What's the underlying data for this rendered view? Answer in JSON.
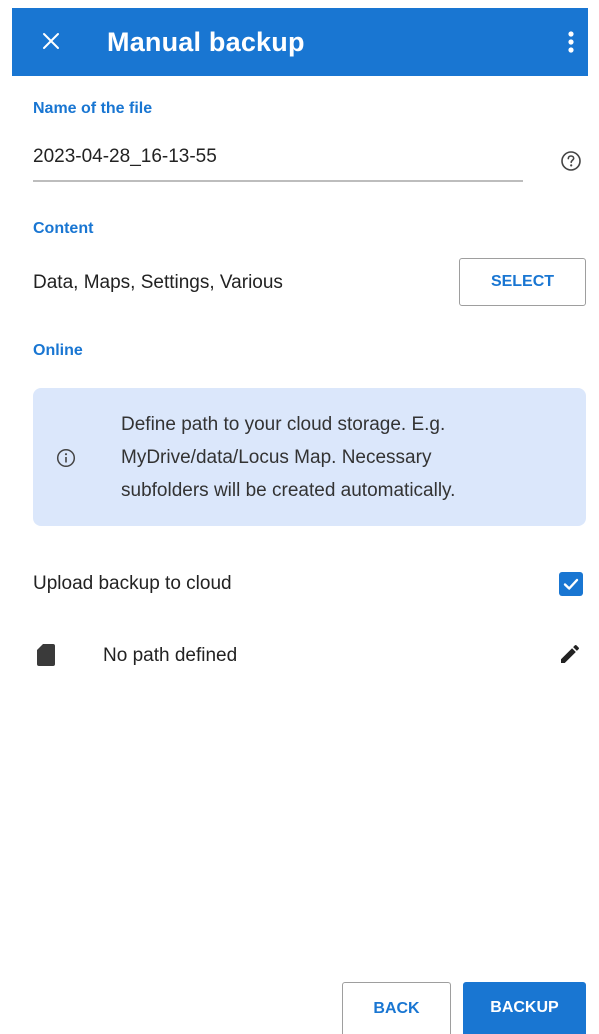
{
  "appbar": {
    "title": "Manual backup",
    "close_icon": "close-icon",
    "more_icon": "more-vert-icon",
    "color": "#1976d2"
  },
  "filename_section": {
    "label": "Name of the file",
    "value": "2023-04-28_16-13-55",
    "help_icon": "help-icon"
  },
  "content_section": {
    "label": "Content",
    "value": "Data, Maps, Settings, Various",
    "select_label": "SELECT"
  },
  "online_section": {
    "label": "Online",
    "info_lines": [
      "Define path to your cloud storage. E.g.",
      "MyDrive/data/Locus Map. Necessary",
      "subfolders will be created automatically."
    ],
    "info_icon": "info-icon",
    "info_bg": "#dbe7fb",
    "upload_label": "Upload backup to cloud",
    "upload_checked": true,
    "path_icon": "sd-card-icon",
    "path_label": "No path defined",
    "edit_icon": "edit-icon"
  },
  "footer": {
    "back_label": "BACK",
    "backup_label": "BACKUP"
  }
}
